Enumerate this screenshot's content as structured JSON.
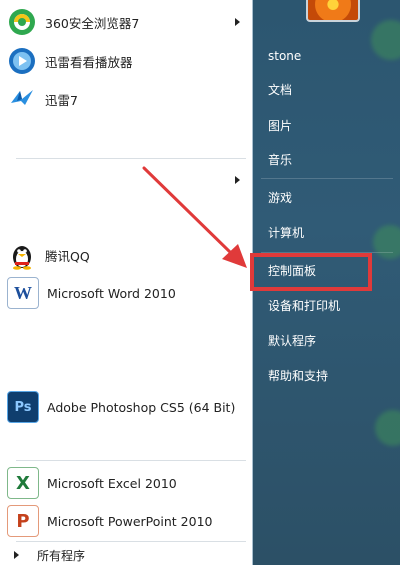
{
  "left_menu": {
    "pinned": [
      {
        "label": "360安全浏览器7",
        "icon": "360-browser-icon",
        "has_submenu": true
      },
      {
        "label": "迅雷看看播放器",
        "icon": "xunlei-player-icon",
        "has_submenu": false
      },
      {
        "label": "迅雷7",
        "icon": "xunlei-bird-icon",
        "has_submenu": false
      }
    ],
    "recent": [
      {
        "label": "腾讯QQ",
        "icon": "qq-penguin-icon"
      },
      {
        "label": "Microsoft Word 2010",
        "icon": "word-icon",
        "glyph": "W"
      },
      {
        "label": "Adobe Photoshop CS5 (64 Bit)",
        "icon": "photoshop-icon",
        "glyph": "Ps"
      },
      {
        "label": "Microsoft Excel 2010",
        "icon": "excel-icon",
        "glyph": "X"
      },
      {
        "label": "Microsoft PowerPoint 2010",
        "icon": "powerpoint-icon",
        "glyph": "P"
      }
    ],
    "all_programs": "所有程序"
  },
  "right_menu": {
    "user": "stone",
    "items": [
      "文档",
      "图片",
      "音乐",
      "游戏",
      "计算机",
      "控制面板",
      "设备和打印机",
      "默认程序",
      "帮助和支持"
    ],
    "highlighted": "控制面板"
  },
  "colors": {
    "highlight": "#e03a3a",
    "panel": "#2c5670"
  }
}
